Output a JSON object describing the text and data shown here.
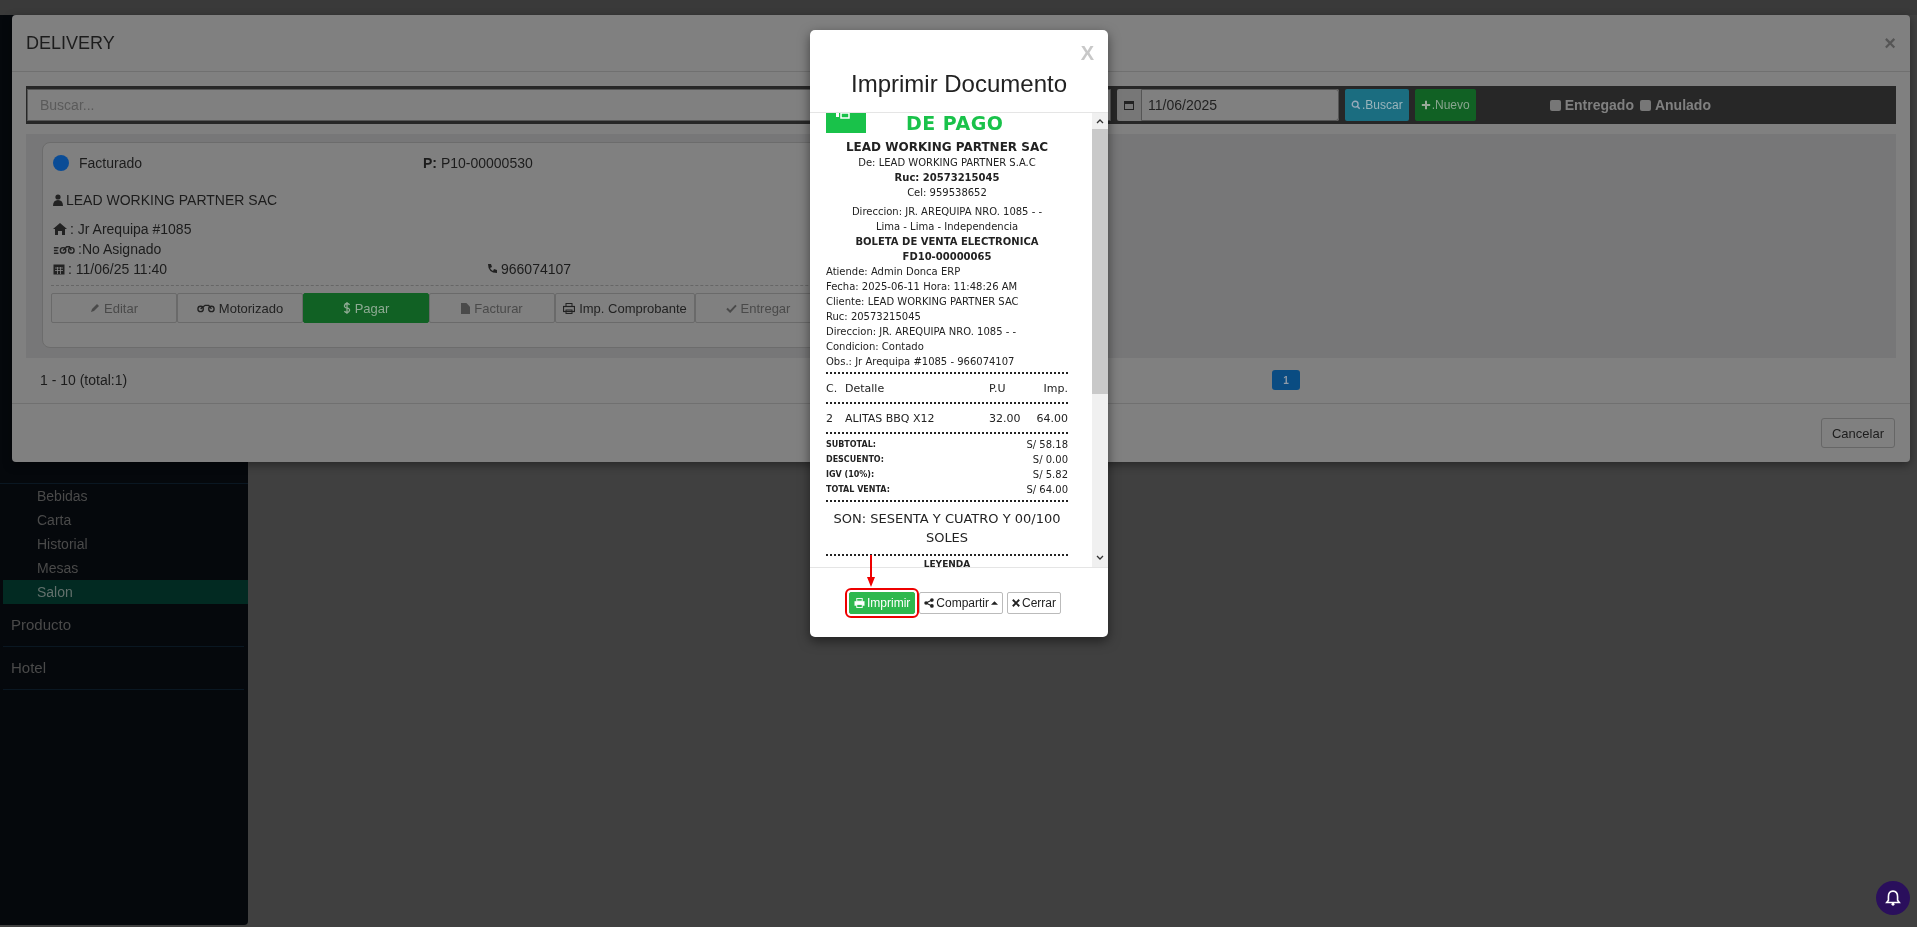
{
  "sidebar": {
    "items": [
      {
        "label": "Bebidas",
        "kind": "sub",
        "selected": false
      },
      {
        "label": "Carta",
        "kind": "sub",
        "selected": false
      },
      {
        "label": "Historial",
        "kind": "sub",
        "selected": false
      },
      {
        "label": "Mesas",
        "kind": "sub",
        "selected": false
      },
      {
        "label": "Salon",
        "kind": "sub",
        "selected": true
      },
      {
        "label": "Producto",
        "kind": "top",
        "selected": false
      },
      {
        "label": "Hotel",
        "kind": "top",
        "selected": false
      }
    ]
  },
  "delivery_modal": {
    "title": "DELIVERY",
    "close": "×",
    "toolbar": {
      "search": {
        "placeholder": "Buscar..."
      },
      "date": "11/06/2025",
      "search_button": ".Buscar",
      "new_button": ".Nuevo",
      "filters": [
        {
          "label": "Entregado",
          "checked": false
        },
        {
          "label": "Anulado",
          "checked": false
        }
      ]
    },
    "order": {
      "status": {
        "label": "Facturado",
        "color": "#0a4c96"
      },
      "order_label": "P:",
      "order_number": "P10-00000530",
      "customer": "LEAD WORKING PARTNER SAC",
      "address": ": Jr Arequipa #1085",
      "driver": ":No Asignado",
      "date": ": 11/06/25 11:40",
      "phone": "966074107",
      "actions": [
        {
          "label": "Editar",
          "kind": "edit",
          "disabled": true
        },
        {
          "label": "Motorizado",
          "kind": "moto",
          "disabled": false
        },
        {
          "label": "Pagar",
          "kind": "pay",
          "disabled": false
        },
        {
          "label": "Facturar",
          "kind": "invoice",
          "disabled": true
        },
        {
          "label": "Imp. Comprobante",
          "kind": "print",
          "disabled": false
        },
        {
          "label": "Entregar",
          "kind": "deliver",
          "disabled": true
        }
      ]
    },
    "pagination": {
      "summary": "1 - 10 (total:1)",
      "pages": [
        {
          "label": "1",
          "selected": true
        }
      ]
    },
    "cancel_button": "Cancelar"
  },
  "print_modal": {
    "title": "Imprimir Documento",
    "close": "X",
    "receipt": {
      "logo_text": "DE PAGO",
      "header": [
        {
          "text": "LEAD WORKING PARTNER SAC",
          "kind": "title"
        },
        {
          "text": "De: LEAD WORKING PARTNER S.A.C",
          "kind": "center"
        },
        {
          "text": "Ruc: 20573215045",
          "kind": "center-bold"
        },
        {
          "text": "Cel: 959538652",
          "kind": "center"
        },
        {
          "text": "Direccion: JR. AREQUIPA NRO. 1085 - -",
          "kind": "center-gap"
        },
        {
          "text": "Lima - Lima - Independencia",
          "kind": "center"
        },
        {
          "text": "BOLETA DE VENTA ELECTRONICA",
          "kind": "center-bold"
        },
        {
          "text": "FD10-00000065",
          "kind": "center-bold"
        },
        {
          "text": "Atiende: Admin Donca ERP",
          "kind": "left"
        },
        {
          "text": "Fecha: 2025-06-11   Hora: 11:48:26 AM",
          "kind": "left"
        },
        {
          "text": "Cliente: LEAD WORKING PARTNER SAC",
          "kind": "left"
        },
        {
          "text": "Ruc: 20573215045",
          "kind": "left"
        },
        {
          "text": "Direccion: JR. AREQUIPA NRO. 1085 - -",
          "kind": "left"
        },
        {
          "text": "Condicion: Contado",
          "kind": "left"
        },
        {
          "text": "Obs.: Jr Arequipa #1085 - 966074107",
          "kind": "left"
        }
      ],
      "columns": [
        "C.",
        "Detalle",
        "P.U",
        "Imp."
      ],
      "items": [
        {
          "qty": "2",
          "detail": "ALITAS BBQ X12",
          "unit_price": "32.00",
          "amount": "64.00"
        }
      ],
      "totals": [
        {
          "label": "SUBTOTAL:",
          "value": "S/ 58.18"
        },
        {
          "label": "DESCUENTO:",
          "value": "S/ 0.00"
        },
        {
          "label": "IGV (10%):",
          "value": "S/ 5.82"
        },
        {
          "label": "TOTAL VENTA:",
          "value": "S/ 64.00"
        }
      ],
      "amount_in_words": "SON: SESENTA Y CUATRO Y 00/100 SOLES",
      "legend": "LEYENDA"
    },
    "buttons": [
      {
        "label": "Imprimir",
        "kind": "print",
        "highlighted": true
      },
      {
        "label": "Compartir",
        "kind": "share",
        "highlighted": false
      },
      {
        "label": "Cerrar",
        "kind": "close",
        "highlighted": false
      }
    ]
  }
}
